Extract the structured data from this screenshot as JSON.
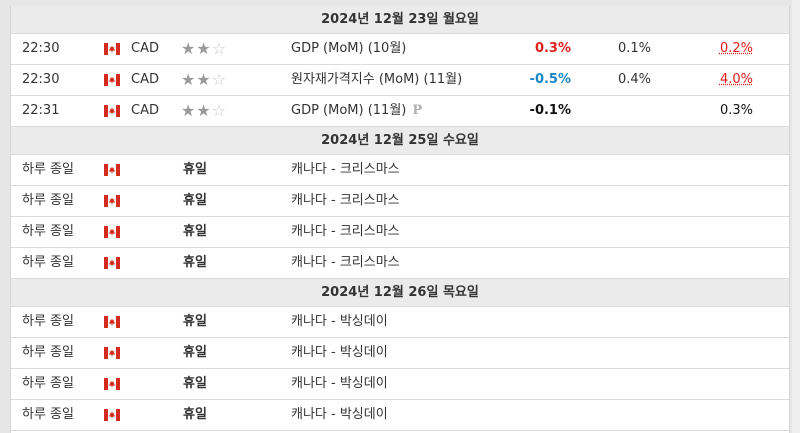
{
  "sections": [
    {
      "date": "2024년 12월 23일 월요일",
      "rows": [
        {
          "time": "22:30",
          "currency": "CAD",
          "event": "GDP (MoM) (10월)",
          "actual": "0.3%",
          "forecast": "0.1%",
          "previous": "0.2%"
        },
        {
          "time": "22:30",
          "currency": "CAD",
          "event": "원자재가격지수 (MoM) (11월)",
          "actual": "-0.5%",
          "forecast": "0.4%",
          "previous": "4.0%"
        },
        {
          "time": "22:31",
          "currency": "CAD",
          "event": "GDP (MoM) (11월)",
          "prelim": "P",
          "actual": "-0.1%",
          "forecast": "",
          "previous": "0.3%"
        }
      ]
    },
    {
      "date": "2024년 12월 25일 수요일",
      "rows": [
        {
          "time": "하루 종일",
          "label": "휴일",
          "event": "캐나다 - 크리스마스"
        },
        {
          "time": "하루 종일",
          "label": "휴일",
          "event": "캐나다 - 크리스마스"
        },
        {
          "time": "하루 종일",
          "label": "휴일",
          "event": "캐나다 - 크리스마스"
        },
        {
          "time": "하루 종일",
          "label": "휴일",
          "event": "캐나다 - 크리스마스"
        }
      ]
    },
    {
      "date": "2024년 12월 26일 목요일",
      "rows": [
        {
          "time": "하루 종일",
          "label": "휴일",
          "event": "캐나다 - 박싱데이"
        },
        {
          "time": "하루 종일",
          "label": "휴일",
          "event": "캐나다 - 박싱데이"
        },
        {
          "time": "하루 종일",
          "label": "휴일",
          "event": "캐나다 - 박싱데이"
        },
        {
          "time": "하루 종일",
          "label": "휴일",
          "event": "캐나다 - 박싱데이"
        }
      ]
    }
  ],
  "importance": {
    "filled": 2,
    "total": 3,
    "icon": "star-icon"
  },
  "flag_icon": "canada-flag-icon",
  "colors": {
    "better": "#e0201c",
    "worse": "#1a86c8",
    "header_bg": "#ebebeb",
    "flag_red": "#d52b1e"
  }
}
